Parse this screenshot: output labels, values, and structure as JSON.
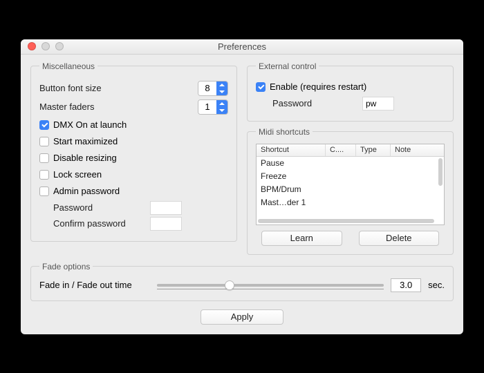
{
  "title": "Preferences",
  "misc": {
    "legend": "Miscellaneous",
    "button_font_size_label": "Button font size",
    "button_font_size_value": "8",
    "master_faders_label": "Master faders",
    "master_faders_value": "1",
    "dmx_on_launch": {
      "label": "DMX On at launch",
      "checked": true
    },
    "start_maximized": {
      "label": "Start maximized",
      "checked": false
    },
    "disable_resizing": {
      "label": "Disable resizing",
      "checked": false
    },
    "lock_screen": {
      "label": "Lock screen",
      "checked": false
    },
    "admin_password": {
      "label": "Admin password",
      "checked": false
    },
    "admin_pw_label": "Password",
    "admin_pw_confirm_label": "Confirm password"
  },
  "external": {
    "legend": "External control",
    "enable": {
      "label": "Enable (requires restart)",
      "checked": true
    },
    "password_label": "Password",
    "password_value": "pw"
  },
  "midi": {
    "legend": "Midi shortcuts",
    "columns": {
      "shortcut": "Shortcut",
      "channel": "C....",
      "type": "Type",
      "note": "Note"
    },
    "rows": [
      "Pause",
      "Freeze",
      "BPM/Drum",
      "Mast…der 1"
    ],
    "learn_label": "Learn",
    "delete_label": "Delete"
  },
  "fade": {
    "legend": "Fade options",
    "label": "Fade in / Fade out time",
    "value": "3.0",
    "unit": "sec."
  },
  "apply_label": "Apply"
}
